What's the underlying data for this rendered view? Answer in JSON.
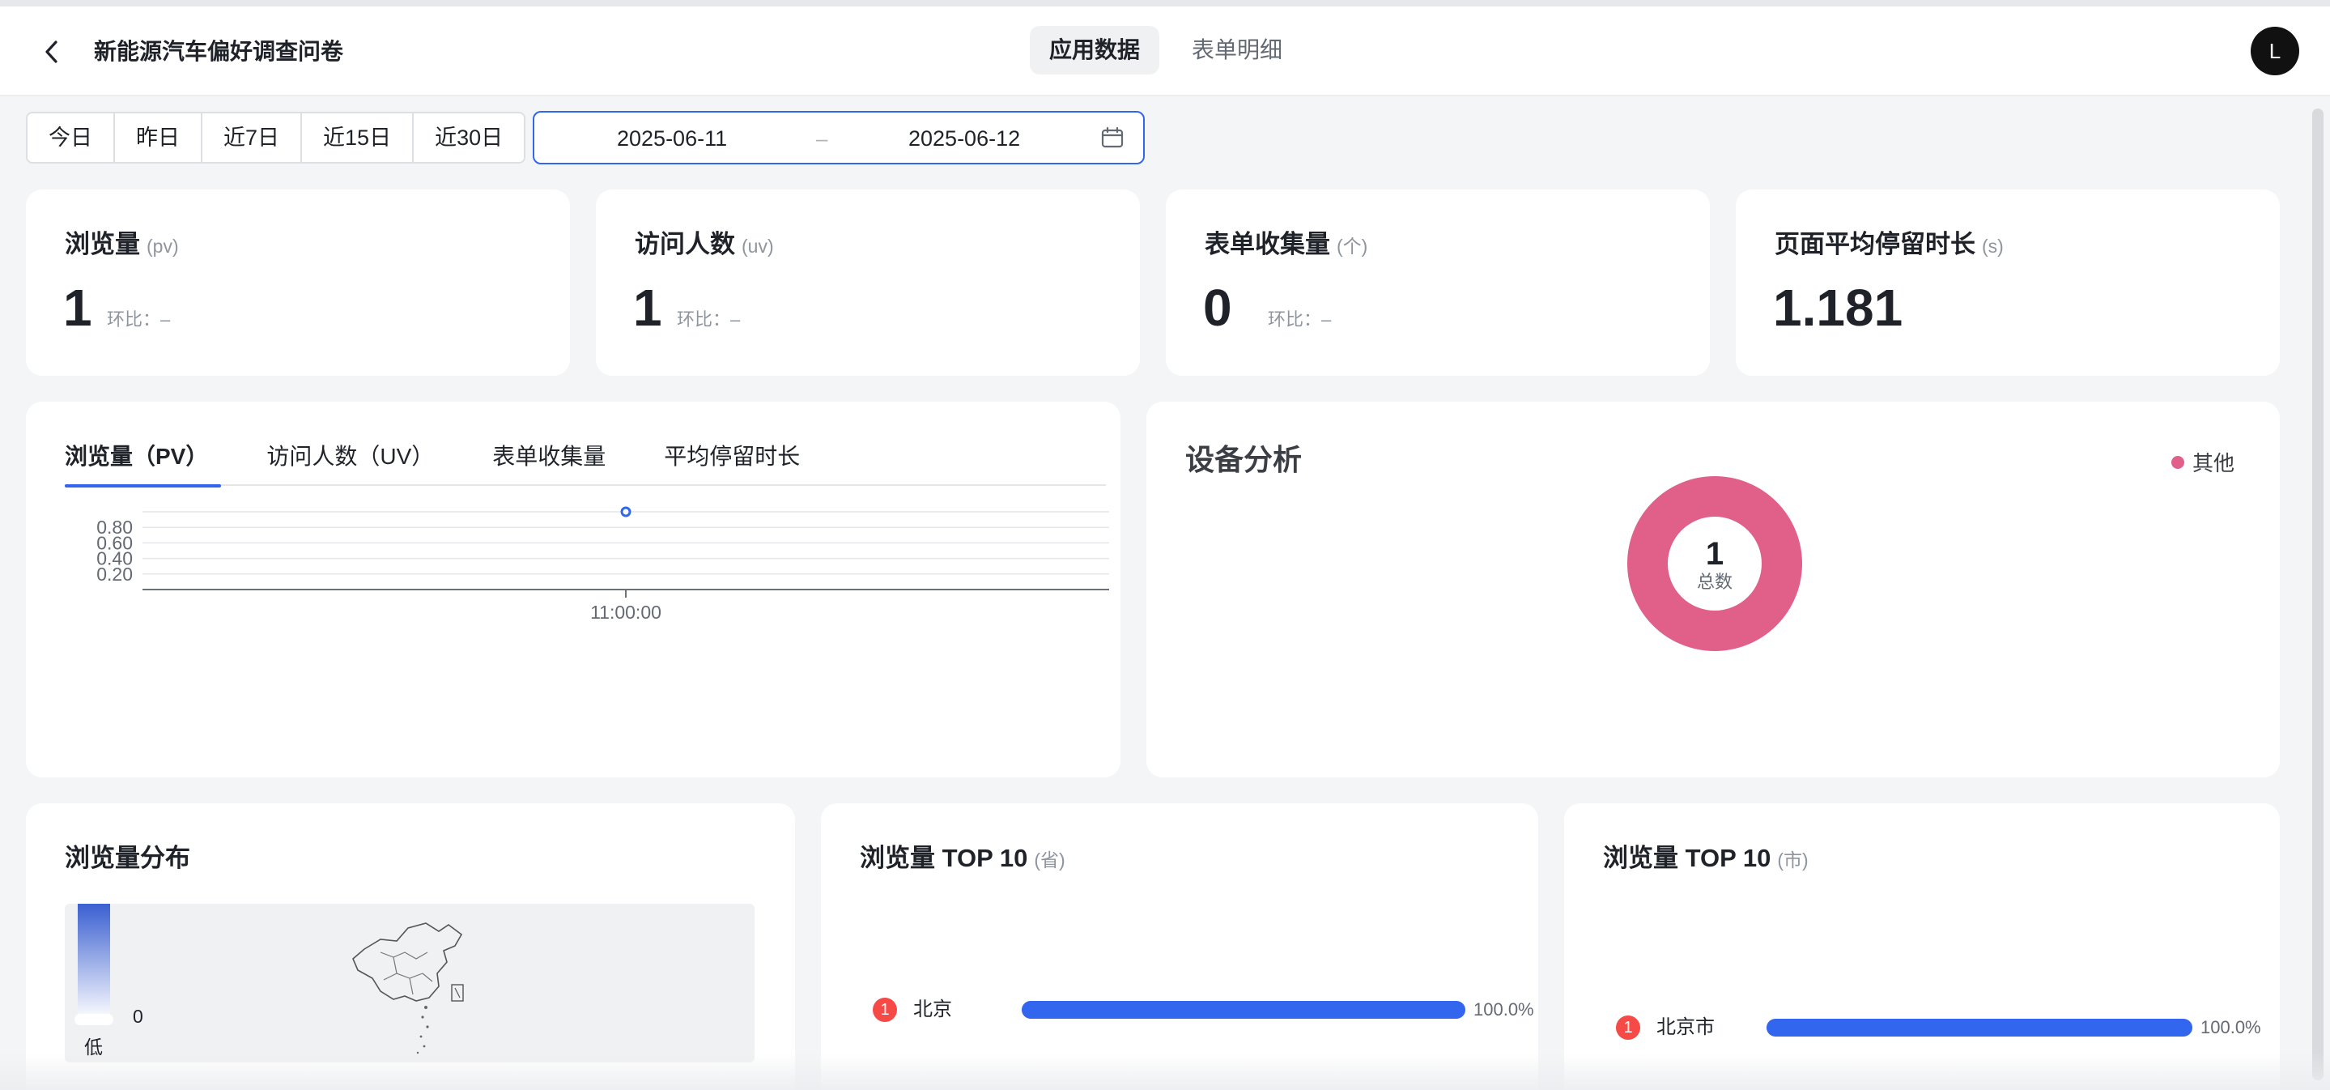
{
  "header": {
    "title": "新能源汽车偏好调查问卷",
    "tabs": [
      {
        "label": "应用数据"
      },
      {
        "label": "表单明细"
      }
    ],
    "active_tab": 0,
    "avatar_initial": "L"
  },
  "filters": {
    "quick_ranges": [
      "今日",
      "昨日",
      "近7日",
      "近15日",
      "近30日"
    ],
    "date_start": "2025-06-11",
    "date_sep": "–",
    "date_end": "2025-06-12"
  },
  "kpis": [
    {
      "label": "浏览量",
      "unit": "(pv)",
      "value": "1",
      "ratio": "环比：–"
    },
    {
      "label": "访问人数",
      "unit": "(uv)",
      "value": "1",
      "ratio": "环比：–"
    },
    {
      "label": "表单收集量",
      "unit": "(个)",
      "value": "0",
      "ratio": "环比：–"
    },
    {
      "label": "页面平均停留时长",
      "unit": "(s)",
      "value": "1.181"
    }
  ],
  "trend": {
    "tabs": [
      "浏览量（PV）",
      "访问人数（UV）",
      "表单收集量",
      "平均停留时长"
    ],
    "active_tab": 0
  },
  "chart_data": {
    "type": "line",
    "x": [
      "11:00:00"
    ],
    "series": [
      {
        "values": [
          1
        ]
      }
    ],
    "yticks": [
      "0.80",
      "0.60",
      "0.40",
      "0.20"
    ],
    "ylim": [
      0,
      1
    ],
    "grid": true,
    "legend": "none"
  },
  "device": {
    "title": "设备分析",
    "legend": [
      {
        "name": "其他",
        "color": "#e0608a"
      }
    ],
    "total": "1",
    "total_label": "总数"
  },
  "distribution": {
    "title": "浏览量分布",
    "scale_min": "0",
    "scale_low_label": "低"
  },
  "top_province": {
    "title": "浏览量 TOP 10",
    "unit": "(省)",
    "rows": [
      {
        "rank": "1",
        "name": "北京",
        "percent_value": 100,
        "percent_label": "100.0%"
      }
    ]
  },
  "top_city": {
    "title": "浏览量 TOP 10",
    "unit": "(市)",
    "rows": [
      {
        "rank": "1",
        "name": "北京市",
        "percent_value": 100,
        "percent_label": "100.0%"
      }
    ]
  },
  "colors": {
    "accent": "#3366ee",
    "donut": "#e0608a",
    "badge": "#f54a45"
  }
}
